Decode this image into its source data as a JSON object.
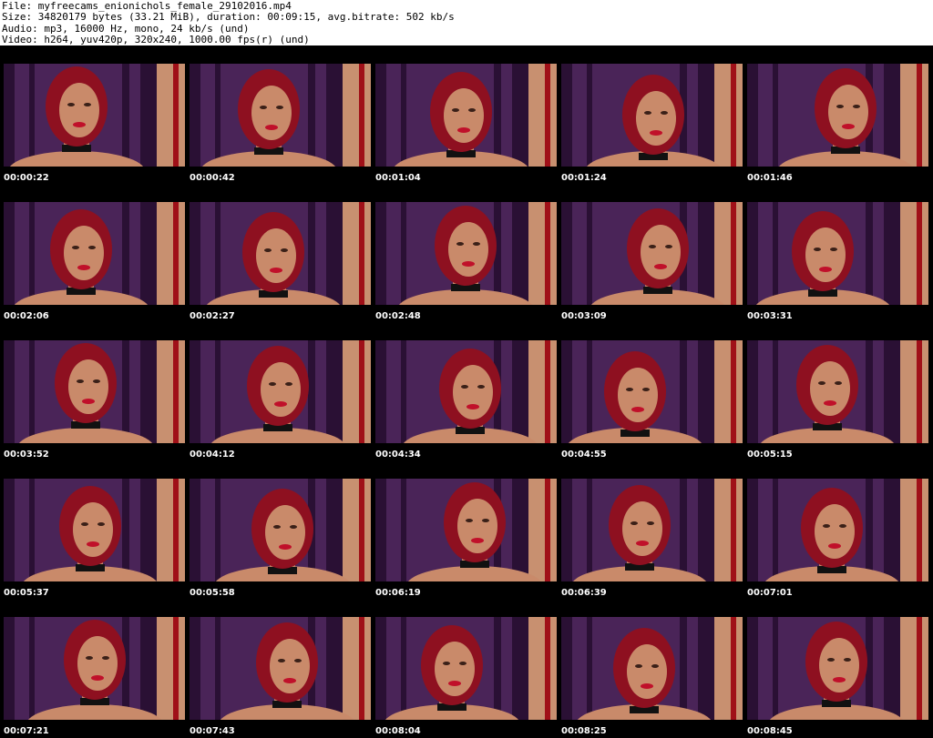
{
  "header": {
    "file_line": "File: myfreecams_enionichols_female_29102016.mp4",
    "size_line": "Size: 34820179 bytes (33.21 MiB), duration: 00:09:15, avg.bitrate: 502 kb/s",
    "audio_line": "Audio: mp3, 16000 Hz, mono, 24 kb/s (und)",
    "video_line": "Video: h264, yuv420p, 320x240, 1000.00 fps(r) (und)"
  },
  "thumbnails": [
    {
      "timestamp": "00:00:22"
    },
    {
      "timestamp": "00:00:42"
    },
    {
      "timestamp": "00:01:04"
    },
    {
      "timestamp": "00:01:24"
    },
    {
      "timestamp": "00:01:46"
    },
    {
      "timestamp": "00:02:06"
    },
    {
      "timestamp": "00:02:27"
    },
    {
      "timestamp": "00:02:48"
    },
    {
      "timestamp": "00:03:09"
    },
    {
      "timestamp": "00:03:31"
    },
    {
      "timestamp": "00:03:52"
    },
    {
      "timestamp": "00:04:12"
    },
    {
      "timestamp": "00:04:34"
    },
    {
      "timestamp": "00:04:55"
    },
    {
      "timestamp": "00:05:15"
    },
    {
      "timestamp": "00:05:37"
    },
    {
      "timestamp": "00:05:58"
    },
    {
      "timestamp": "00:06:19"
    },
    {
      "timestamp": "00:06:39"
    },
    {
      "timestamp": "00:07:01"
    },
    {
      "timestamp": "00:07:21"
    },
    {
      "timestamp": "00:07:43"
    },
    {
      "timestamp": "00:08:04"
    },
    {
      "timestamp": "00:08:25"
    },
    {
      "timestamp": "00:08:45"
    }
  ],
  "colors": {
    "background": "#ffffff",
    "sheet": "#000000",
    "curtain": "#4a2458",
    "curtain_dark": "#2a1034",
    "hair": "#8e1020",
    "skin": "#c98a6a",
    "lips": "#c0102a",
    "wall_right": "#c89070"
  }
}
